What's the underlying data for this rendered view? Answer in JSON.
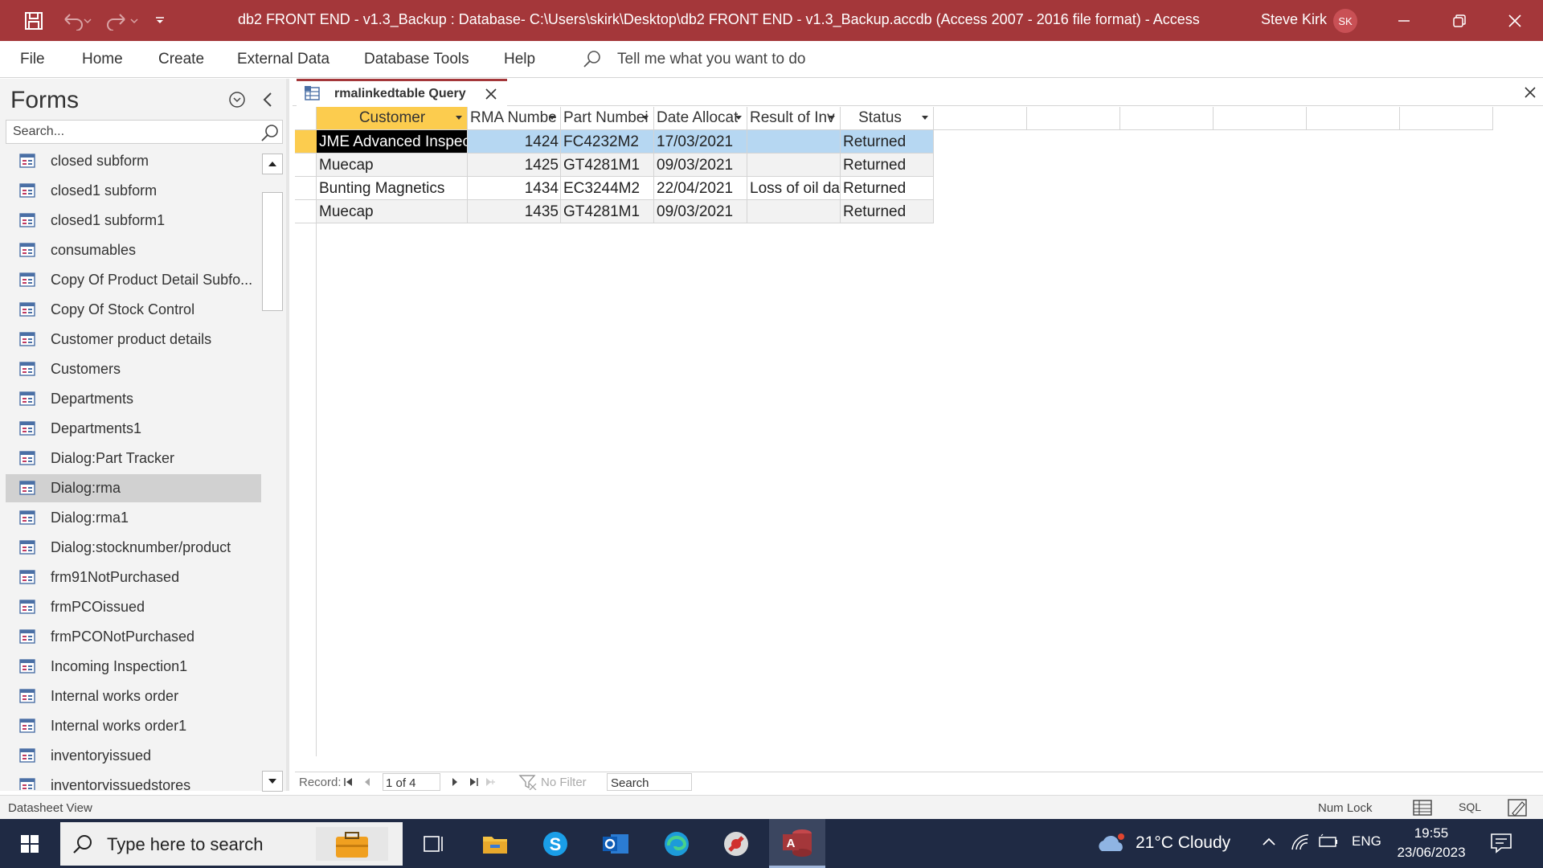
{
  "window": {
    "title": "db2 FRONT END - v1.3_Backup : Database- C:\\Users\\skirk\\Desktop\\db2 FRONT END - v1.3_Backup.accdb (Access 2007 - 2016 file format)  -  Access",
    "user_name": "Steve Kirk",
    "user_initials": "SK"
  },
  "ribbon": {
    "tabs": [
      "File",
      "Home",
      "Create",
      "External Data",
      "Database Tools",
      "Help"
    ],
    "tell_me": "Tell me what you want to do"
  },
  "nav_pane": {
    "title": "Forms",
    "search_placeholder": "Search...",
    "items": [
      "closed subform",
      "closed1 subform",
      "closed1 subform1",
      "consumables",
      "Copy Of Product Detail Subfo...",
      "Copy Of Stock Control",
      "Customer product details",
      "Customers",
      "Departments",
      "Departments1",
      "Dialog:Part Tracker",
      "Dialog:rma",
      "Dialog:rma1",
      "Dialog:stocknumber/product",
      "frm91NotPurchased",
      "frmPCOissued",
      "frmPCONotPurchased",
      "Incoming Inspection1",
      "Internal works order",
      "Internal works order1",
      "inventoryissued",
      "inventoryissuedstores"
    ],
    "selected_item": "Dialog:rma"
  },
  "document": {
    "tab_label": "rmalinkedtable Query",
    "columns": [
      "Customer",
      "RMA Numbe",
      "Part Numbei",
      "Date Allocat",
      "Result of Inv",
      "Status"
    ],
    "rows": [
      [
        "JME Advanced Inspection",
        "1424",
        "FC4232M2",
        "17/03/2021",
        "",
        "Returned"
      ],
      [
        "Muecap",
        "1425",
        "GT4281M1",
        "09/03/2021",
        "",
        "Returned"
      ],
      [
        "Bunting Magnetics",
        "1434",
        "EC3244M2",
        "22/04/2021",
        "Loss of oil dam",
        "Returned"
      ],
      [
        "Muecap",
        "1435",
        "GT4281M1",
        "09/03/2021",
        "",
        "Returned"
      ]
    ]
  },
  "record_nav": {
    "label": "Record:",
    "position": "1 of 4",
    "filter": "No Filter",
    "search": "Search"
  },
  "status_bar": {
    "left": "Datasheet View",
    "num_lock": "Num Lock",
    "sql": "SQL"
  },
  "taskbar": {
    "search_placeholder": "Type here to search",
    "weather": "21°C  Cloudy",
    "language": "ENG",
    "time": "19:55",
    "date": "23/06/2023"
  },
  "colors": {
    "accent": "#a4373a",
    "header_active": "#fccc4e",
    "selected_row": "#b6d7f2",
    "taskbar": "#1f2a44"
  }
}
